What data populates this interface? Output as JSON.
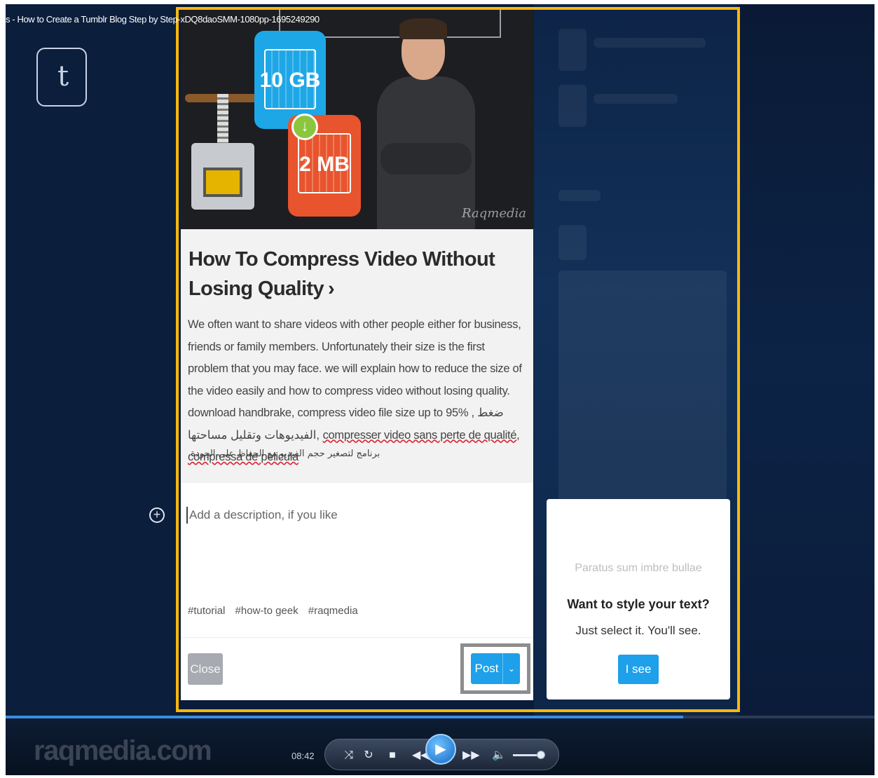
{
  "window": {
    "file_title": "s - How to Create a Tumblr Blog Step by Step-xDQ8daoSMM-1080pp-1695249290"
  },
  "thumbnail": {
    "tile_large": "10 GB",
    "tile_small": "2 MB",
    "watermark": "Raqmedia"
  },
  "post": {
    "title": "How To Compress Video Without Losing Quality",
    "title_chevron": "›",
    "body_line1": "We often want to share videos with other people either for business, friends or family members. Unfortunately their size is the first problem that you may face. we will explain how to reduce the size of the video easily and how to compress video without losing quality. download handbrake, compress video file size up to 95% , ضغط الفيديوهات وتقليل مساحتها, ",
    "body_fr": "compresser video sans perte de qualité",
    "body_sep": ", ",
    "body_es": "compressa de pelicula",
    "body_arabic": "برنامج لتصغير حجم الفيديو مع الحفاظ على الجودة."
  },
  "editor": {
    "description_placeholder": "Add a description, if you like",
    "tags": [
      "#tutorial",
      "#how-to geek",
      "#raqmedia"
    ],
    "close_label": "Close",
    "post_label": "Post",
    "post_caret": "⌄"
  },
  "tip": {
    "sample_text": "Paratus sum imbre bullae",
    "heading": "Want to style your text?",
    "subtext": "Just select it. You'll see.",
    "button_label": "I see"
  },
  "player": {
    "brand": "raqmedia.com",
    "time": "08:42",
    "seek_progress": 0.78,
    "volume": 0.95
  }
}
